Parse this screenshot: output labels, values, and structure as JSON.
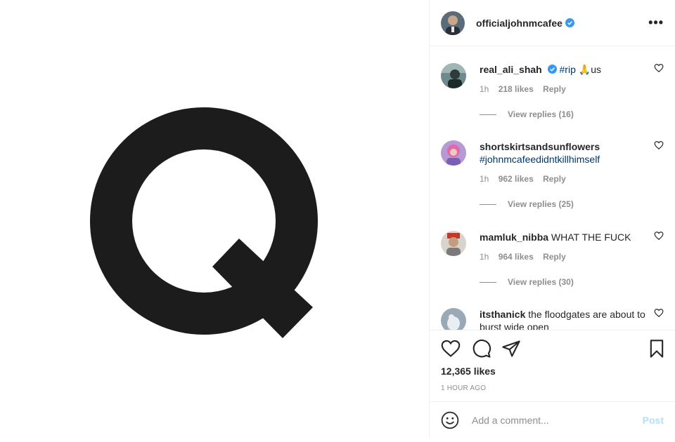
{
  "post": {
    "author": "officialjohnmcafee",
    "author_verified": true,
    "image": {
      "letter": "Q",
      "icon": "q-logo-image"
    },
    "more_icon": "more-options-icon"
  },
  "comments": [
    {
      "user": "real_ali_shah",
      "verified": true,
      "hashtag": "#rip",
      "emoji": "🙏",
      "text": "us",
      "time": "1h",
      "likes": "218 likes",
      "reply": "Reply",
      "view_replies": "View replies (16)"
    },
    {
      "user": "shortskirtsandsunflowers",
      "verified": false,
      "hashtag": "#johnmcafeedidntkillhimself",
      "text": "",
      "time": "1h",
      "likes": "962 likes",
      "reply": "Reply",
      "view_replies": "View replies (25)"
    },
    {
      "user": "mamluk_nibba",
      "verified": false,
      "text": "WHAT THE FUCK",
      "time": "1h",
      "likes": "964 likes",
      "reply": "Reply",
      "view_replies": "View replies (30)"
    },
    {
      "user": "itsthanick",
      "verified": false,
      "text": "the floodgates are about to burst wide open"
    }
  ],
  "actions": {
    "likes": "12,365 likes",
    "time": "1 HOUR AGO",
    "icons": [
      "heart-icon",
      "comment-icon",
      "share-icon",
      "bookmark-icon"
    ]
  },
  "add_comment": {
    "placeholder": "Add a comment...",
    "post_label": "Post",
    "emoji_icon": "emoji-smile-icon"
  },
  "colors": {
    "hashtag": "#00376b",
    "verified": "#3897f0",
    "post_disabled": "#b2dffc",
    "muted": "#8e8e8e"
  }
}
